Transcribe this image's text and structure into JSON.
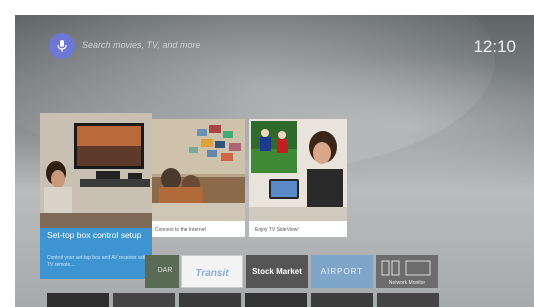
{
  "search": {
    "placeholder": "Search movies, TV, and more"
  },
  "clock": "12:10",
  "cards": [
    {
      "caption": "Connect to the Internet"
    },
    {
      "caption": "Enjoy TV SideView!"
    }
  ],
  "hero": {
    "title": "Set-top box control setup",
    "description": "Control your set-top box and AV receiver with TV remote..."
  },
  "apps": [
    "DAR",
    "Transit",
    "Stock Market",
    "AIRPORT",
    "Network Monitor"
  ],
  "colors": {
    "accent": "#3d94d0",
    "mic": "#6d77d6"
  }
}
